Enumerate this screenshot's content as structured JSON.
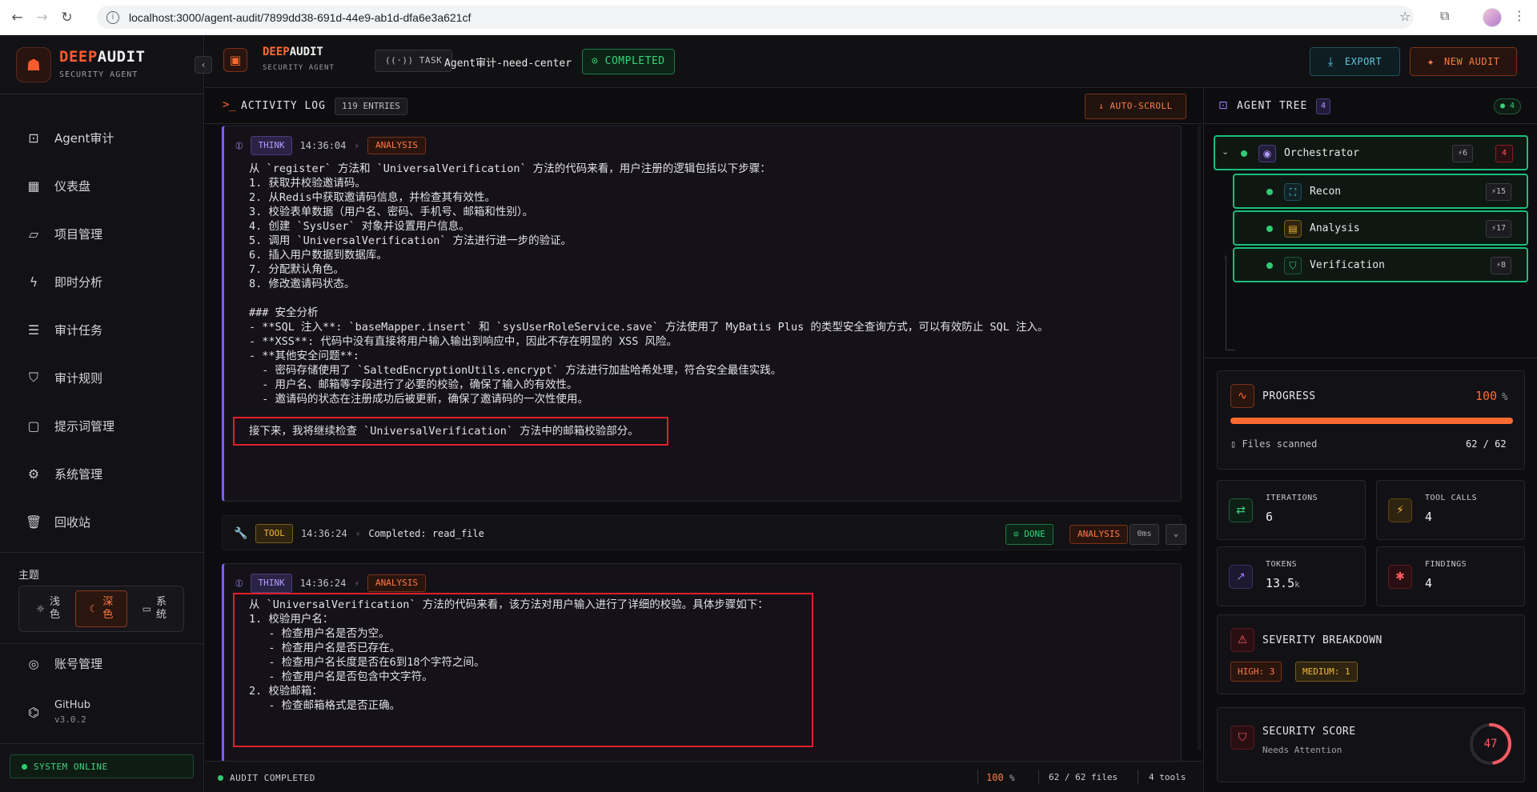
{
  "browser": {
    "url": "localhost:3000/agent-audit/7899dd38-691d-44e9-ab1d-dfa6e3a621cf"
  },
  "sidebar": {
    "brand_a": "DEEP",
    "brand_b": "AUDIT",
    "brand_sub": "SECURITY AGENT",
    "items": [
      {
        "label": "Agent审计",
        "icon": "bot-icon"
      },
      {
        "label": "仪表盘",
        "icon": "dashboard-icon"
      },
      {
        "label": "项目管理",
        "icon": "folder-icon"
      },
      {
        "label": "即时分析",
        "icon": "lightning-icon"
      },
      {
        "label": "审计任务",
        "icon": "list-icon"
      },
      {
        "label": "审计规则",
        "icon": "shield-icon"
      },
      {
        "label": "提示词管理",
        "icon": "message-icon"
      },
      {
        "label": "系统管理",
        "icon": "gear-icon"
      },
      {
        "label": "回收站",
        "icon": "trash-icon"
      }
    ],
    "theme_label": "主题",
    "themes": [
      {
        "line1": "浅",
        "line2": "色"
      },
      {
        "line1": "深",
        "line2": "色"
      },
      {
        "line1": "系",
        "line2": "统"
      }
    ],
    "account": "账号管理",
    "github": "GitHub",
    "version": "v3.0.2",
    "system_status": "SYSTEM ONLINE"
  },
  "header": {
    "brand_a": "DEEP",
    "brand_b": "AUDIT",
    "brand_sub": "SECURITY AGENT",
    "task_tag": "TASK",
    "task_name": "Agent审计-need-center",
    "status": "COMPLETED",
    "export": "EXPORT",
    "new_audit": "NEW AUDIT"
  },
  "activity": {
    "title": "ACTIVITY LOG",
    "entries": "119 ENTRIES",
    "autoscroll": "AUTO-SCROLL",
    "card1": {
      "tag": "THINK",
      "time": "14:36:04",
      "phase": "ANALYSIS",
      "lines": [
        "从 `register` 方法和 `UniversalVerification` 方法的代码来看，用户注册的逻辑包括以下步骤：",
        "1. 获取并校验邀请码。",
        "2. 从Redis中获取邀请码信息，并检查其有效性。",
        "3. 校验表单数据（用户名、密码、手机号、邮箱和性别）。",
        "4. 创建 `SysUser` 对象并设置用户信息。",
        "5. 调用 `UniversalVerification` 方法进行进一步的验证。",
        "6. 插入用户数据到数据库。",
        "7. 分配默认角色。",
        "8. 修改邀请码状态。",
        "",
        "### 安全分析",
        "- **SQL 注入**: `baseMapper.insert` 和 `sysUserRoleService.save` 方法使用了 MyBatis Plus 的类型安全查询方式，可以有效防止 SQL 注入。",
        "- **XSS**: 代码中没有直接将用户输入输出到响应中，因此不存在明显的 XSS 风险。",
        "- **其他安全问题**:",
        "  - 密码存储使用了 `SaltedEncryptionUtils.encrypt` 方法进行加盐哈希处理，符合安全最佳实践。",
        "  - 用户名、邮箱等字段进行了必要的校验，确保了输入的有效性。",
        "  - 邀请码的状态在注册成功后被更新，确保了邀请码的一次性使用。"
      ],
      "final_line": "接下来，我将继续检查 `UniversalVerification` 方法中的邮箱校验部分。"
    },
    "tool": {
      "tag": "TOOL",
      "time": "14:36:24",
      "text": "Completed: read_file",
      "done": "DONE",
      "phase": "ANALYSIS",
      "duration": "0ms"
    },
    "card2": {
      "tag": "THINK",
      "time": "14:36:24",
      "phase": "ANALYSIS",
      "lines": [
        "从 `UniversalVerification` 方法的代码来看，该方法对用户输入进行了详细的校验。具体步骤如下：",
        "1. 校验用户名：",
        "   - 检查用户名是否为空。",
        "   - 检查用户名是否已存在。",
        "   - 检查用户名长度是否在6到18个字符之间。",
        "   - 检查用户名是否包含中文字符。",
        "2. 校验邮箱：",
        "   - 检查邮箱格式是否正确。"
      ]
    }
  },
  "statusbar": {
    "label": "AUDIT COMPLETED",
    "percent": "100",
    "percent_unit": "%",
    "files": "62 / 62 files",
    "tools": "4 tools"
  },
  "tree": {
    "title": "AGENT TREE",
    "count": "4",
    "live": "4",
    "nodes": [
      {
        "name": "Orchestrator",
        "calls": "6",
        "findings": "4",
        "icon": "cpu-icon"
      },
      {
        "name": "Recon",
        "calls": "15",
        "icon": "scan-icon"
      },
      {
        "name": "Analysis",
        "calls": "17",
        "icon": "file-code-icon"
      },
      {
        "name": "Verification",
        "calls": "8",
        "icon": "shield-check-icon"
      }
    ]
  },
  "progress": {
    "title": "PROGRESS",
    "value": "100",
    "unit": "%",
    "fraction": 1.0,
    "files_label": "Files scanned",
    "files_value": "62 / 62"
  },
  "stats": [
    {
      "label": "ITERATIONS",
      "value": "6",
      "icon": "refresh-icon"
    },
    {
      "label": "TOOL CALLS",
      "value": "4",
      "icon": "lightning-icon"
    },
    {
      "label": "TOKENS",
      "value": "13.5",
      "unit": "k",
      "icon": "trend-icon"
    },
    {
      "label": "FINDINGS",
      "value": "4",
      "icon": "bug-icon"
    }
  ],
  "severity": {
    "title": "SEVERITY BREAKDOWN",
    "high": "HIGH: 3",
    "medium": "MEDIUM: 1"
  },
  "score": {
    "title": "SECURITY SCORE",
    "subtitle": "Needs Attention",
    "value": "47"
  },
  "colors": {
    "accent": "#ff6a30",
    "green": "#2ecc71",
    "purple": "#7c5cff",
    "red": "#e0202a"
  }
}
